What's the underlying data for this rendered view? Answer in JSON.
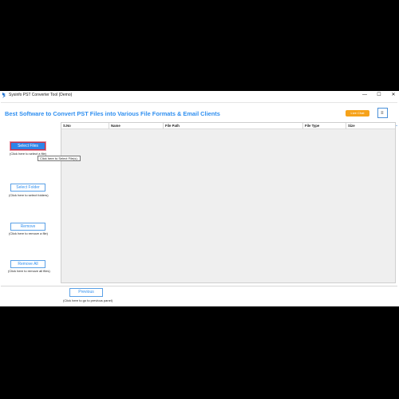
{
  "window": {
    "title": "Sysinfo PST Converter Tool (Demo)",
    "minimize_glyph": "—",
    "maximize_glyph": "☐",
    "close_glyph": "✕"
  },
  "banner": {
    "title": "Best Software to Convert PST Files into Various File Formats & Email Clients",
    "live_chat_label": "Live Chat",
    "menu_glyph": "≡"
  },
  "actions": {
    "select_files": {
      "label": "Select Files",
      "hint": "(Click here to select a file)"
    },
    "select_folder": {
      "label": "Select Folder",
      "hint": "(Click here to select folders)"
    },
    "remove": {
      "label": "Remove",
      "hint": "(Click here to remove a file)"
    },
    "remove_all": {
      "label": "Remove All",
      "hint": "(Click here to remove all files)"
    }
  },
  "tooltip": "Click here to Select File(s).",
  "table": {
    "columns": [
      "S.No",
      "Name",
      "File Path",
      "File Type",
      "Size"
    ]
  },
  "footer": {
    "previous_label": "Previous",
    "previous_hint": "(Click here to go to previous panel)"
  },
  "colors": {
    "accent": "#2f8ff0",
    "live_chat": "#f6a21a",
    "table_bg": "#efefef"
  }
}
